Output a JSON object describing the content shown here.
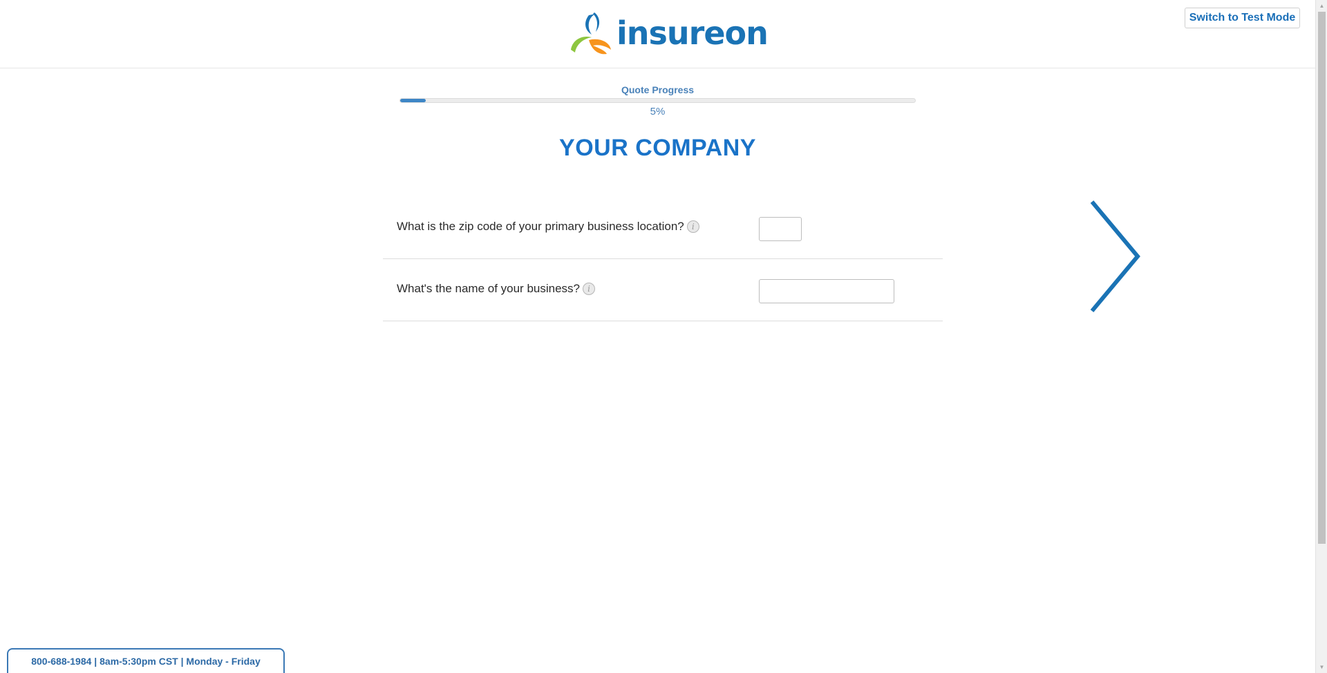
{
  "header": {
    "logo_text": "insureon",
    "test_mode_button": "Switch to Test Mode"
  },
  "progress": {
    "label": "Quote Progress",
    "percent_text": "5%",
    "fraction": 0.05
  },
  "section": {
    "title": "YOUR COMPANY"
  },
  "questions": [
    {
      "label": "What is the zip code of your primary business location?",
      "value": ""
    },
    {
      "label": "What's the name of your business?",
      "value": ""
    }
  ],
  "icons": {
    "info": "info-icon",
    "next": "chevron-right-icon"
  },
  "footer": {
    "contact": "800-688-1984 | 8am-5:30pm CST | Monday - Friday"
  },
  "colors": {
    "brand_blue": "#1a73b5",
    "accent_blue": "#1a73c8",
    "logo_green": "#8dc63f",
    "logo_orange": "#f7941d"
  }
}
